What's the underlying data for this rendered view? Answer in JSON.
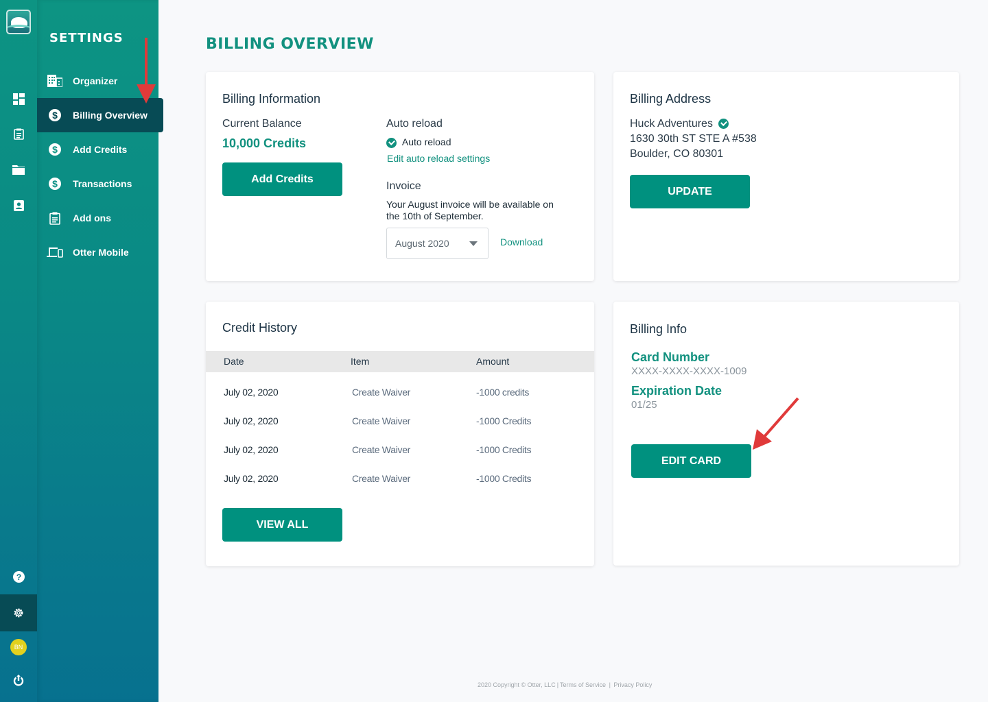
{
  "rail": {
    "icons": [
      "otter-logo",
      "dashboard-icon",
      "clipboard-icon",
      "folder-icon",
      "contact-icon",
      "help-icon",
      "gear-icon",
      "avatar",
      "power-icon"
    ],
    "avatar_initials": "BN"
  },
  "settings": {
    "title": "SETTINGS",
    "items": [
      {
        "label": "Organizer",
        "icon": "building-icon"
      },
      {
        "label": "Billing Overview",
        "icon": "dollar-icon",
        "active": true
      },
      {
        "label": "Add Credits",
        "icon": "dollar-icon"
      },
      {
        "label": "Transactions",
        "icon": "dollar-icon"
      },
      {
        "label": "Add ons",
        "icon": "clipboard-icon"
      },
      {
        "label": "Otter Mobile",
        "icon": "devices-icon"
      }
    ]
  },
  "page": {
    "title": "BILLING OVERVIEW"
  },
  "billing_information": {
    "title": "Billing Information",
    "balance_label": "Current Balance",
    "balance_value": "10,000 Credits",
    "add_credits_button": "Add Credits",
    "auto_reload_label": "Auto reload",
    "auto_reload_status": "Auto reload",
    "edit_auto_reload_link": "Edit auto reload settings",
    "invoice_label": "Invoice",
    "invoice_note": "Your August invoice will be available on the 10th of September.",
    "invoice_select_value": "August 2020",
    "download_link": "Download"
  },
  "billing_address": {
    "title": "Billing Address",
    "name": "Huck Adventures",
    "line1": "1630 30th ST STE A #538",
    "line2": "Boulder, CO 80301",
    "update_button": "UPDATE"
  },
  "credit_history": {
    "title": "Credit History",
    "columns": [
      "Date",
      "Item",
      "Amount"
    ],
    "rows": [
      [
        "July 02, 2020",
        "Create Waiver",
        "-1000 credits"
      ],
      [
        "July 02, 2020",
        "Create Waiver",
        "-1000 Credits"
      ],
      [
        "July 02, 2020",
        "Create Waiver",
        "-1000 Credits"
      ],
      [
        "July 02, 2020",
        "Create Waiver",
        "-1000 Credits"
      ]
    ],
    "view_all_button": "VIEW ALL"
  },
  "billing_info": {
    "title": "Billing Info",
    "card_number_label": "Card Number",
    "card_number_value": "XXXX-XXXX-XXXX-1009",
    "expiration_label": "Expiration Date",
    "expiration_value": "01/25",
    "edit_card_button": "EDIT CARD"
  },
  "footer": {
    "copyright": "2020 Copyright © Otter, LLC",
    "terms": "Terms of Service",
    "privacy": "Privacy Policy"
  },
  "colors": {
    "brand": "#00917f",
    "sidebar_active": "#074b55",
    "annotation_arrow": "#e03a3a"
  }
}
